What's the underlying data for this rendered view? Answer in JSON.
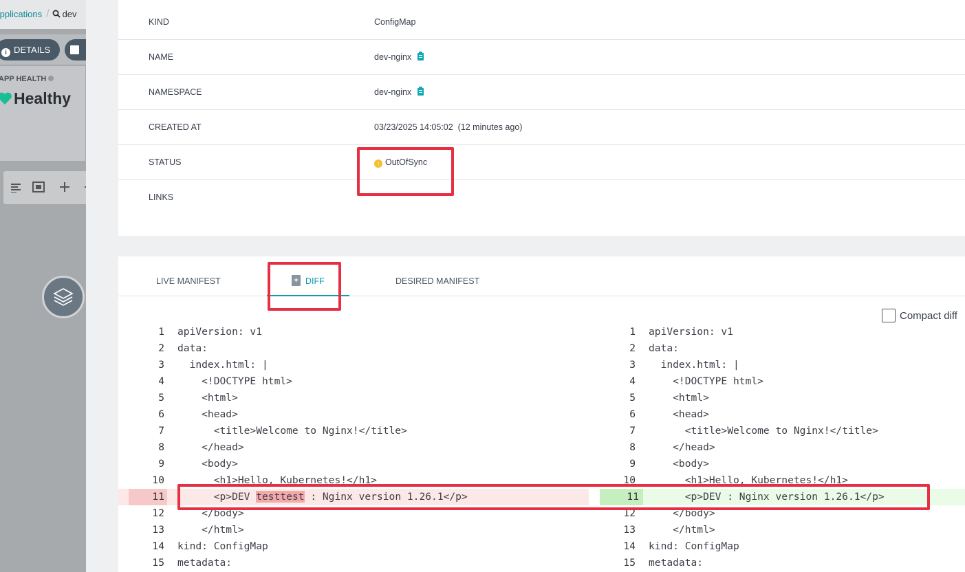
{
  "background": {
    "breadcrumb_app": "Applications",
    "breadcrumb_sep": "/",
    "breadcrumb_search": "dev",
    "details_button": "DETAILS",
    "app_health_label": "APP HEALTH",
    "app_health_value": "Healthy"
  },
  "properties": {
    "kind_label": "KIND",
    "kind_value": "ConfigMap",
    "name_label": "NAME",
    "name_value": "dev-nginx",
    "namespace_label": "NAMESPACE",
    "namespace_value": "dev-nginx",
    "created_label": "CREATED AT",
    "created_value": "03/23/2025 14:05:02  (12 minutes ago)",
    "status_label": "STATUS",
    "status_value": "OutOfSync",
    "links_label": "LINKS"
  },
  "tabs": {
    "live": "LIVE MANIFEST",
    "diff": "DIFF",
    "desired": "DESIRED MANIFEST"
  },
  "compact_diff_label": "Compact diff",
  "diff_left": [
    {
      "n": "1",
      "code": "apiVersion: v1"
    },
    {
      "n": "2",
      "code": "data:"
    },
    {
      "n": "3",
      "code": "  index.html: |"
    },
    {
      "n": "4",
      "code": "    <!DOCTYPE html>"
    },
    {
      "n": "5",
      "code": "    <html>"
    },
    {
      "n": "6",
      "code": "    <head>"
    },
    {
      "n": "7",
      "code": "      <title>Welcome to Nginx!</title>"
    },
    {
      "n": "8",
      "code": "    </head>"
    },
    {
      "n": "9",
      "code": "    <body>"
    },
    {
      "n": "10",
      "code": "      <h1>Hello, Kubernetes!</h1>"
    },
    {
      "n": "11",
      "pre": "      <p>DEV ",
      "mark": "testtest",
      "post": " : Nginx version 1.26.1</p>",
      "state": "removed"
    },
    {
      "n": "12",
      "code": "    </body>"
    },
    {
      "n": "13",
      "code": "    </html>"
    },
    {
      "n": "14",
      "code": "kind: ConfigMap"
    },
    {
      "n": "15",
      "code": "metadata:"
    }
  ],
  "diff_right": [
    {
      "n": "1",
      "code": "apiVersion: v1"
    },
    {
      "n": "2",
      "code": "data:"
    },
    {
      "n": "3",
      "code": "  index.html: |"
    },
    {
      "n": "4",
      "code": "    <!DOCTYPE html>"
    },
    {
      "n": "5",
      "code": "    <html>"
    },
    {
      "n": "6",
      "code": "    <head>"
    },
    {
      "n": "7",
      "code": "      <title>Welcome to Nginx!</title>"
    },
    {
      "n": "8",
      "code": "    </head>"
    },
    {
      "n": "9",
      "code": "    <body>"
    },
    {
      "n": "10",
      "code": "      <h1>Hello, Kubernetes!</h1>"
    },
    {
      "n": "11",
      "code": "      <p>DEV : Nginx version 1.26.1</p>",
      "state": "added"
    },
    {
      "n": "12",
      "code": "    </body>"
    },
    {
      "n": "13",
      "code": "    </html>"
    },
    {
      "n": "14",
      "code": "kind: ConfigMap"
    },
    {
      "n": "15",
      "code": "metadata:"
    }
  ],
  "colors": {
    "accent": "#0e9ab0",
    "annotation_red": "#e62f43",
    "status_outofsync": "#f4c030",
    "health_green": "#18be94"
  }
}
